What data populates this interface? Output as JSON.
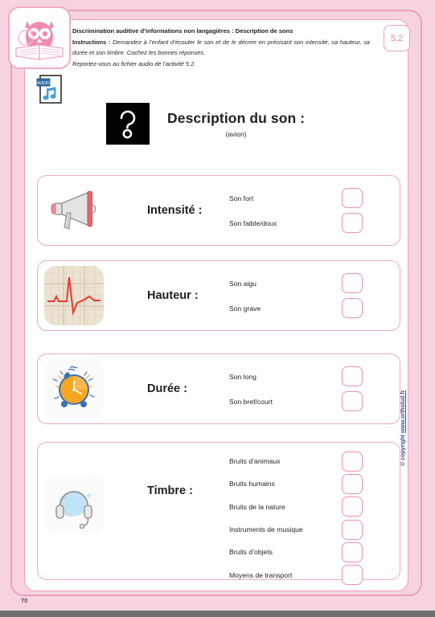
{
  "header": {
    "title": "Discrimination auditive d’informations non langagières : Description de sons",
    "instructions_label": "Instructions :",
    "instructions_text": " Demandez à l’enfant d’écouter le son et de le décrire en précisant son intensité, sa hauteur, sa durée et son timbre. Cochez les bonnes réponses.",
    "reference": "Reportez-vous au fichier audio de l’activité 5.2.",
    "badge": "5.2",
    "logo_name": "owl-reading-book-logo",
    "audio_icon_label": "AUDIO"
  },
  "title": {
    "main": "Description du son :",
    "sub": "(avion)",
    "icon_name": "question-mark-icon"
  },
  "cards": [
    {
      "id": "intensite",
      "label": "Intensité :",
      "icon": "megaphone-icon",
      "options": [
        "Son fort",
        "Son faible/doux"
      ]
    },
    {
      "id": "hauteur",
      "label": "Hauteur :",
      "icon": "waveform-ecg-icon",
      "options": [
        "Son aigu",
        "Son grave"
      ]
    },
    {
      "id": "duree",
      "label": "Durée :",
      "icon": "alarm-clock-icon",
      "options": [
        "Son long",
        "Son bref/court"
      ]
    },
    {
      "id": "timbre",
      "label": "Timbre :",
      "icon": "headphones-icon",
      "options": [
        "Bruits d’animaux",
        "Bruits humains",
        "Bruits de la nature",
        "Instruments de musique",
        "Bruits d’objets",
        "Moyens de transport"
      ]
    }
  ],
  "footer": {
    "page_number": "70",
    "copyright_prefix": "© copyright ",
    "copyright_url": "www.ortholud.fr"
  },
  "colors": {
    "page_background": "#f7d3e0",
    "panel": "#ffffff",
    "accent_pink": "#ef9fbe",
    "checkbox_border": "#ef8fb4",
    "text": "#231f20",
    "copyright_blue": "#3b4fa0"
  }
}
